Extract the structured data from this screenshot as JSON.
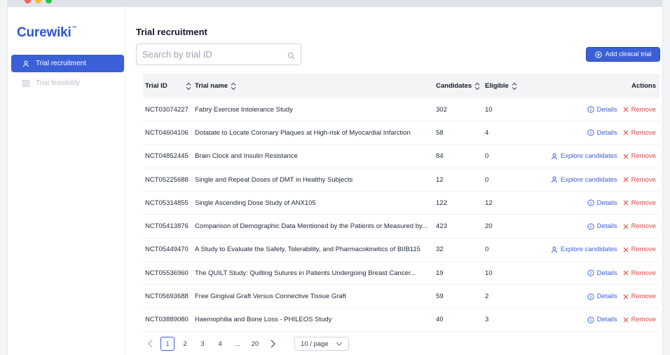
{
  "app": {
    "logo": "Curewiki",
    "logo_mark": "™"
  },
  "sidebar": {
    "items": [
      {
        "label": "Trial recruitment",
        "icon": "user-icon",
        "active": true
      },
      {
        "label": "Trial feasibility",
        "icon": "grid-icon",
        "active": false
      }
    ]
  },
  "main": {
    "title": "Trial recruitment",
    "search": {
      "placeholder": "Search by trial ID",
      "value": ""
    },
    "add_button": "Add clinical trial"
  },
  "table": {
    "headers": {
      "id": "Trial ID",
      "name": "Trial name",
      "candidates": "Candidates",
      "eligible": "Eligible",
      "actions": "Actions"
    },
    "action_labels": {
      "details": "Details",
      "explore": "Explore candidates",
      "remove": "Remove"
    },
    "rows": [
      {
        "id": "NCT03074227",
        "name": "Fabry Exercise Intolerance Study",
        "candidates": "302",
        "eligible": "10",
        "action": "details"
      },
      {
        "id": "NCT04604106",
        "name": "Dotatate to Locate Coronary Plaques at High-risk of Myocardial Infarction",
        "candidates": "58",
        "eligible": "4",
        "action": "details"
      },
      {
        "id": "NCT04852445",
        "name": "Brain Clock and Insulin Resistance",
        "candidates": "84",
        "eligible": "0",
        "action": "explore"
      },
      {
        "id": "NCT05225688",
        "name": "Single and Repeat Doses of DMT in Healthy Subjects",
        "candidates": "12",
        "eligible": "0",
        "action": "explore"
      },
      {
        "id": "NCT05314855",
        "name": "Single Ascending Dose Study of ANX105",
        "candidates": "122",
        "eligible": "12",
        "action": "details"
      },
      {
        "id": "NCT05413876",
        "name": "Comparison of Demographic Data Mentioned by the Patients or Measured by...",
        "candidates": "423",
        "eligible": "20",
        "action": "details"
      },
      {
        "id": "NCT05449470",
        "name": "A Study to Evaluate the Safety, Tolerability, and Pharmacokinetics of BIIB115",
        "candidates": "32",
        "eligible": "0",
        "action": "explore"
      },
      {
        "id": "NCT05536960",
        "name": "The QUILT Study: Quilting Sutures in Patients Undergoing Breast Cancer...",
        "candidates": "19",
        "eligible": "10",
        "action": "details"
      },
      {
        "id": "NCT05693688",
        "name": "Free Gingival Graft Versus Connective Tissue Graft",
        "candidates": "59",
        "eligible": "2",
        "action": "details"
      },
      {
        "id": "NCT03889080",
        "name": "Haemophilia and Bone Loss - PHILEOS Study",
        "candidates": "40",
        "eligible": "3",
        "action": "details"
      }
    ]
  },
  "pagination": {
    "pages": [
      "1",
      "2",
      "3",
      "4",
      "...",
      "20"
    ],
    "current": "1",
    "per_page": "10 / page"
  },
  "colors": {
    "accent": "#3b5fd6",
    "danger": "#e04848"
  }
}
